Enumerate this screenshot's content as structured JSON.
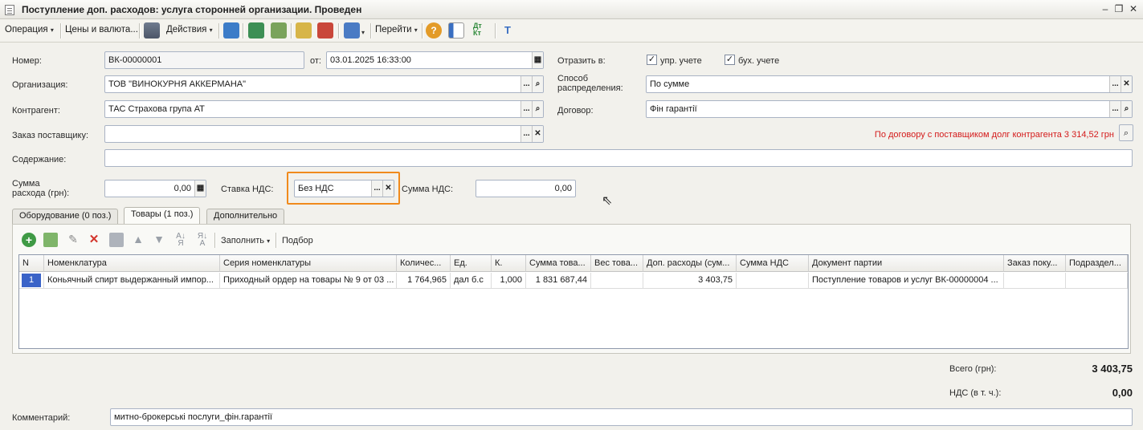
{
  "window": {
    "title": "Поступление доп. расходов: услуга сторонней организации. Проведен"
  },
  "toolbar": {
    "operation_label": "Операция",
    "prices_label": "Цены и валюта...",
    "actions_label": "Действия",
    "goto_label": "Перейти",
    "icon_dtkt": "Дт Кт"
  },
  "form": {
    "number_label": "Номер:",
    "number_value": "ВК-00000001",
    "from_label": "от:",
    "date_value": "03.01.2025 16:33:00",
    "reflect_label": "Отразить в:",
    "mgmt_label": "упр. учете",
    "acc_label": "бух. учете",
    "org_label": "Организация:",
    "org_value": "ТОВ \"ВИНОКУРНЯ АККЕРМАНА\"",
    "distribution_label_1": "Способ",
    "distribution_label_2": "распределения:",
    "distribution_value": "По сумме",
    "counterparty_label": "Контрагент:",
    "counterparty_value": "ТАС Страхова група АТ",
    "contract_label": "Договор:",
    "contract_value": "Фін гарантії",
    "supplier_order_label": "Заказ поставщику:",
    "supplier_order_value": "",
    "debt_text": "По договору с поставщиком долг контрагента 3 314,52 грн",
    "content_label": "Содержание:",
    "content_value": "",
    "expense_label_1": "Сумма",
    "expense_label_2": "расхода (грн):",
    "expense_value": "0,00",
    "vat_rate_label": "Ставка НДС:",
    "vat_rate_value": "Без НДС",
    "vat_sum_label": "Сумма НДС:",
    "vat_sum_value": "0,00"
  },
  "tabs": [
    {
      "label": "Оборудование (0 поз.)"
    },
    {
      "label": "Товары (1 поз.)"
    },
    {
      "label": "Дополнительно"
    }
  ],
  "table_toolbar": {
    "fill_label": "Заполнить",
    "select_label": "Подбор"
  },
  "table": {
    "columns": [
      "N",
      "Номенклатура",
      "Серия номенклатуры",
      "Количес...",
      "Ед.",
      "К.",
      "Сумма това...",
      "Вес това...",
      "Доп. расходы (сум...",
      "Сумма НДС",
      "Документ партии",
      "Заказ поку...",
      "Подраздел..."
    ],
    "rows": [
      [
        "1",
        "Коньячный спирт выдержанный импор...",
        "Приходный ордер на товары № 9 от 03 ...",
        "1 764,965",
        "дал б.с",
        "1,000",
        "1 831 687,44",
        "",
        "3 403,75",
        "",
        "Поступление товаров и услуг ВК-00000004 ...",
        "",
        ""
      ]
    ]
  },
  "totals": {
    "total_label": "Всего (грн):",
    "total_value": "3 403,75",
    "vat_label": "НДС (в т. ч.):",
    "vat_value": "0,00"
  },
  "comment": {
    "label": "Комментарий:",
    "value": "митно-брокерські послуги_фін.гарантії"
  },
  "colors": {
    "accent_highlight": "#f08a1c",
    "warning_text": "#d41b1b",
    "row_selection": "#3a63c8"
  }
}
